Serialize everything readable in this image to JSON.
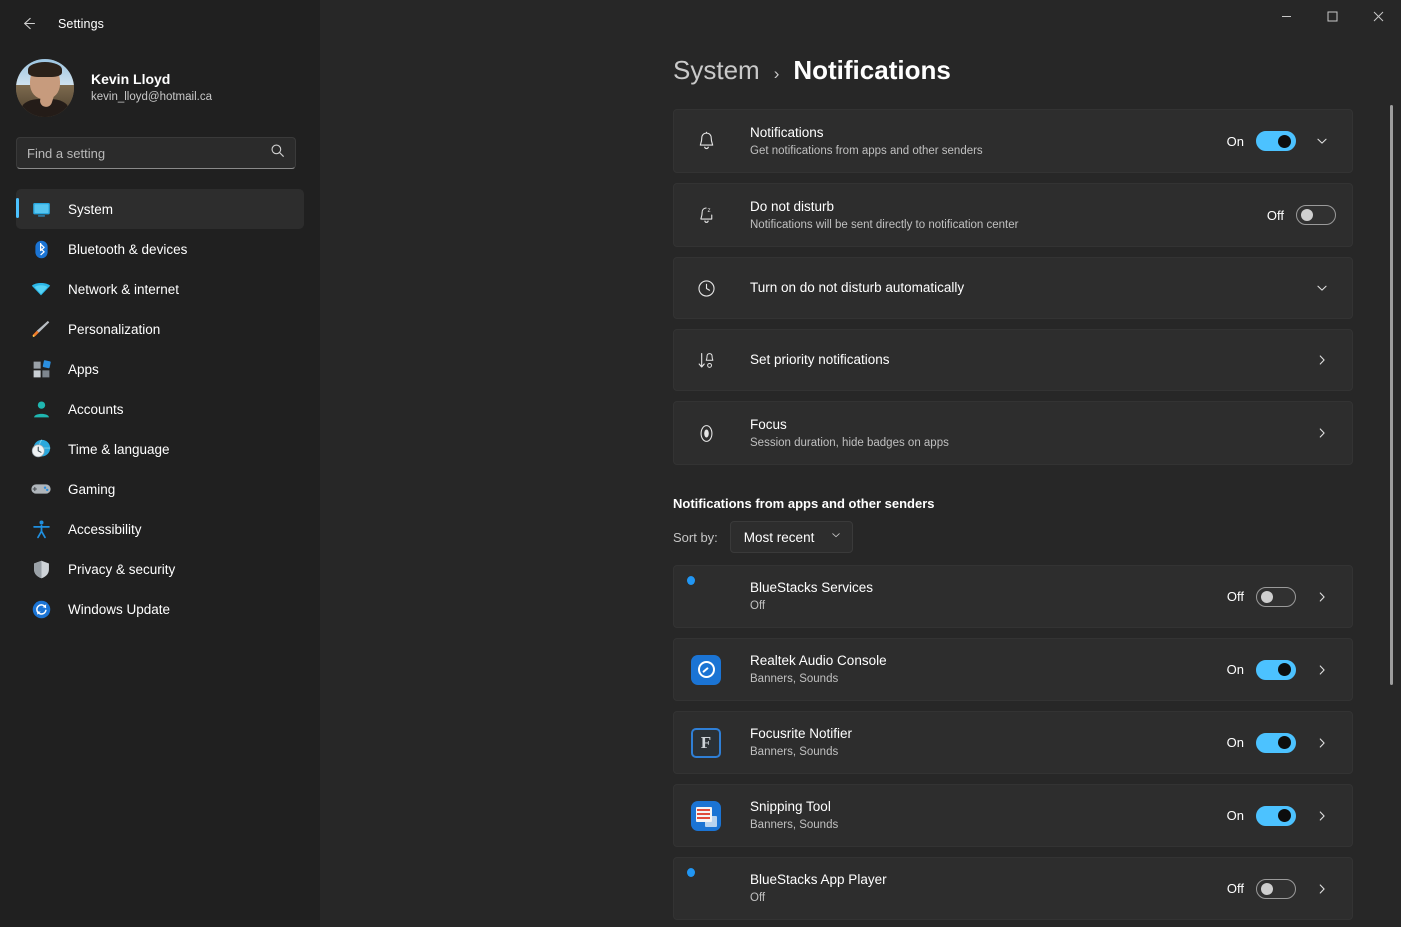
{
  "titlebar": {
    "back_icon": "back-arrow-icon",
    "title": "Settings",
    "minimize_label": "—",
    "maximize_label": "□",
    "close_label": "✕"
  },
  "sidebar": {
    "profile": {
      "name": "Kevin Lloyd",
      "email": "kevin_lloyd@hotmail.ca",
      "avatar_name": "user-avatar"
    },
    "search": {
      "placeholder": "Find a setting",
      "value": "",
      "icon": "search-icon"
    },
    "items": [
      {
        "label": "System",
        "icon": "monitor-icon",
        "active": true
      },
      {
        "label": "Bluetooth & devices",
        "icon": "bluetooth-icon",
        "active": false
      },
      {
        "label": "Network & internet",
        "icon": "wifi-icon",
        "active": false
      },
      {
        "label": "Personalization",
        "icon": "paintbrush-icon",
        "active": false
      },
      {
        "label": "Apps",
        "icon": "apps-grid-icon",
        "active": false
      },
      {
        "label": "Accounts",
        "icon": "person-icon",
        "active": false
      },
      {
        "label": "Time & language",
        "icon": "clock-globe-icon",
        "active": false
      },
      {
        "label": "Gaming",
        "icon": "gamepad-icon",
        "active": false
      },
      {
        "label": "Accessibility",
        "icon": "accessibility-person-icon",
        "active": false
      },
      {
        "label": "Privacy & security",
        "icon": "shield-icon",
        "active": false
      },
      {
        "label": "Windows Update",
        "icon": "refresh-sync-icon",
        "active": false
      }
    ]
  },
  "breadcrumb": {
    "parent": "System",
    "separator": "›",
    "current": "Notifications"
  },
  "settings_cards": [
    {
      "title": "Notifications",
      "subtitle": "Get notifications from apps and other senders",
      "icon": "bell-icon",
      "state_label": "On",
      "toggle": "on",
      "trailing": "chevron-down-icon"
    },
    {
      "title": "Do not disturb",
      "subtitle": "Notifications will be sent directly to notification center",
      "icon": "bell-sleep-icon",
      "state_label": "Off",
      "toggle": "off",
      "trailing": "none"
    },
    {
      "title": "Turn on do not disturb automatically",
      "subtitle": "",
      "icon": "clock-icon",
      "state_label": "",
      "toggle": "none",
      "trailing": "chevron-down-icon"
    },
    {
      "title": "Set priority notifications",
      "subtitle": "",
      "icon": "priority-sort-icon",
      "state_label": "",
      "toggle": "none",
      "trailing": "chevron-right-icon"
    },
    {
      "title": "Focus",
      "subtitle": "Session duration, hide badges on apps",
      "icon": "focus-target-icon",
      "state_label": "",
      "toggle": "none",
      "trailing": "chevron-right-icon"
    }
  ],
  "apps_section": {
    "heading": "Notifications from apps and other senders",
    "sort_label": "Sort by:",
    "sort_value": "Most recent",
    "sort_icon": "chevron-down-icon",
    "apps": [
      {
        "name": "BlueStacks Services",
        "status": "Off",
        "icon": "bluestacks-icon",
        "state_label": "Off",
        "toggle": "off",
        "trailing": "chevron-right-icon"
      },
      {
        "name": "Realtek Audio Console",
        "status": "Banners, Sounds",
        "icon": "realtek-icon",
        "state_label": "On",
        "toggle": "on",
        "trailing": "chevron-right-icon"
      },
      {
        "name": "Focusrite Notifier",
        "status": "Banners, Sounds",
        "icon": "focusrite-icon",
        "state_label": "On",
        "toggle": "on",
        "trailing": "chevron-right-icon"
      },
      {
        "name": "Snipping Tool",
        "status": "Banners, Sounds",
        "icon": "snipping-tool-icon",
        "state_label": "On",
        "toggle": "on",
        "trailing": "chevron-right-icon"
      },
      {
        "name": "BlueStacks App Player",
        "status": "Off",
        "icon": "bluestacks-icon",
        "state_label": "Off",
        "toggle": "off",
        "trailing": "chevron-right-icon"
      }
    ]
  },
  "colors": {
    "accent": "#4cc2ff",
    "window_bg": "#272727",
    "sidebar_bg": "#202020",
    "card_bg": "#2d2d2d"
  }
}
